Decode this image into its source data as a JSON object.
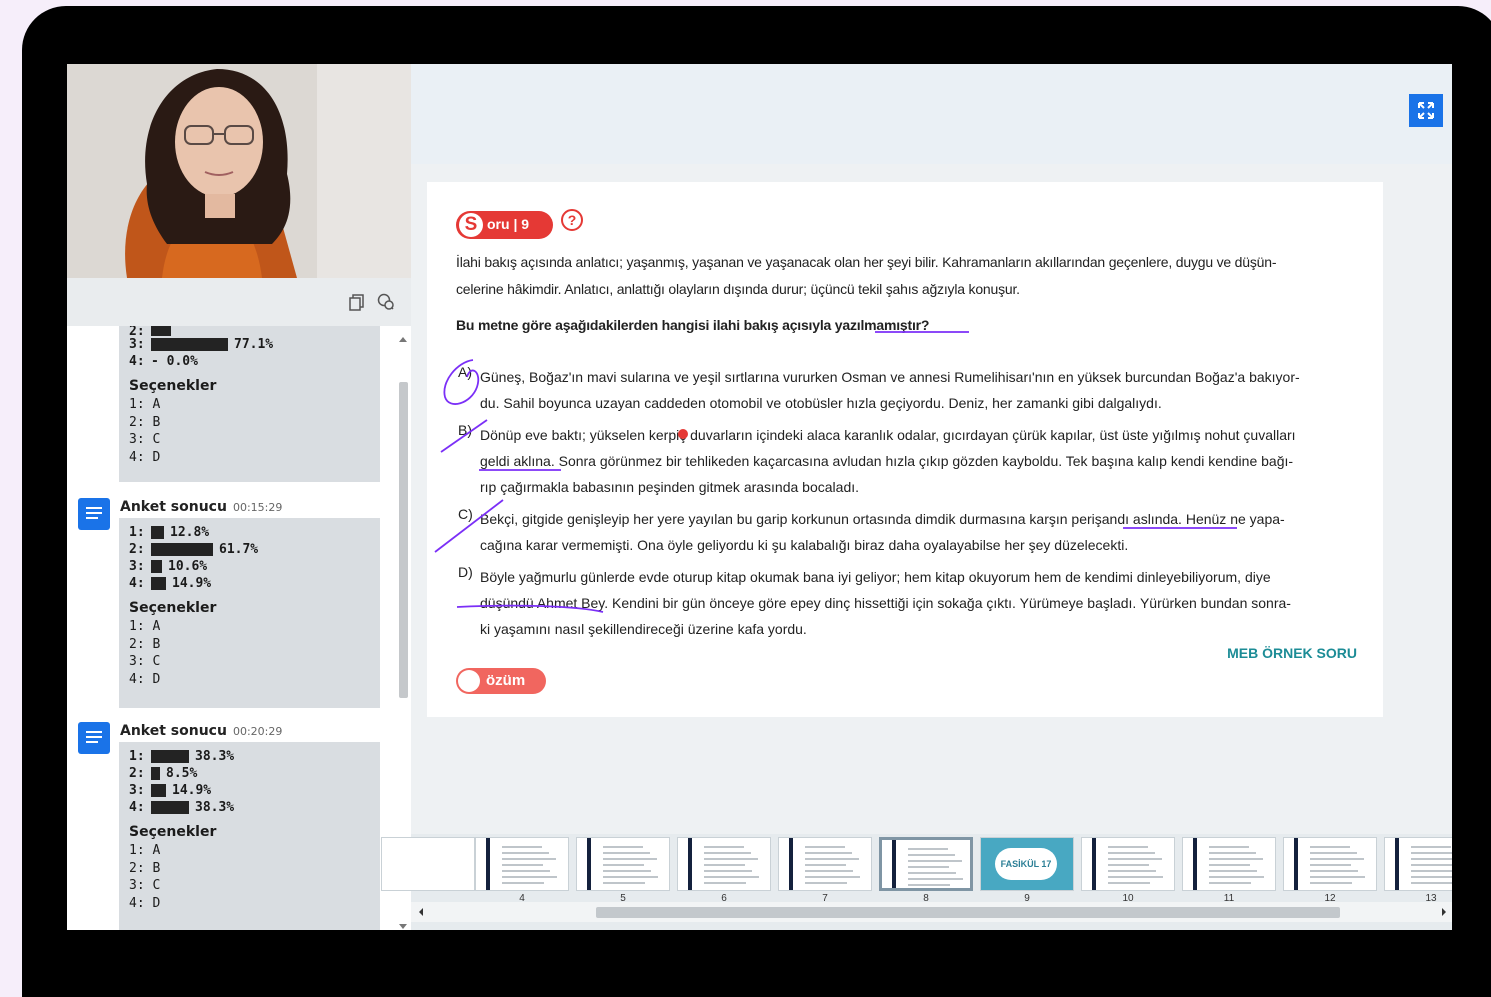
{
  "left_panel": {
    "partial_poll": {
      "rows": [
        {
          "n": "3:",
          "pct": "77.1%",
          "fill": 0.771
        },
        {
          "n": "4:",
          "pct": "- 0.0%",
          "fill": 0.0
        }
      ],
      "options_title": "Seçenekler",
      "options": [
        "1: A",
        "2: B",
        "3: C",
        "4: D"
      ]
    },
    "polls": [
      {
        "title": "Anket sonucu",
        "time": "00:15:29",
        "rows": [
          {
            "n": "1:",
            "pct": "12.8%",
            "fill": 0.128
          },
          {
            "n": "2:",
            "pct": "61.7%",
            "fill": 0.617
          },
          {
            "n": "3:",
            "pct": "10.6%",
            "fill": 0.106
          },
          {
            "n": "4:",
            "pct": "14.9%",
            "fill": 0.149
          }
        ],
        "options_title": "Seçenekler",
        "options": [
          "1: A",
          "2: B",
          "3: C",
          "4: D"
        ]
      },
      {
        "title": "Anket sonucu",
        "time": "00:20:29",
        "rows": [
          {
            "n": "1:",
            "pct": "38.3%",
            "fill": 0.383
          },
          {
            "n": "2:",
            "pct": "8.5%",
            "fill": 0.085
          },
          {
            "n": "3:",
            "pct": "14.9%",
            "fill": 0.149
          },
          {
            "n": "4:",
            "pct": "38.3%",
            "fill": 0.383
          }
        ],
        "options_title": "Seçenekler",
        "options": [
          "1: A",
          "2: B",
          "3: C",
          "4: D"
        ]
      }
    ]
  },
  "question": {
    "badge": "oru | 9",
    "badge_letter": "S",
    "help": "?",
    "passage": [
      "İlahi bakış açısında anlatıcı; yaşanmış, yaşanan ve yaşanacak olan her şeyi bilir. Kahramanların akıllarından geçenlere, duygu ve düşün-",
      "celerine hâkimdir. Anlatıcı, anlattığı olayların dışında durur; üçüncü tekil şahıs ağzıyla konuşur."
    ],
    "prompt": "Bu metne göre aşağıdakilerden hangisi ilahi bakış açısıyla yazılmamıştır?",
    "options": [
      {
        "letter": "A)",
        "lines": [
          "Güneş, Boğaz'ın mavi sularına ve yeşil sırtlarına vururken Osman ve annesi Rumelihisarı'nın en yüksek burcundan Boğaz'a bakıyor-",
          "du. Sahil boyunca uzayan caddeden otomobil ve otobüsler hızla geçiyordu. Deniz, her zamanki gibi dalgalıydı."
        ]
      },
      {
        "letter": "B)",
        "lines": [
          "Dönüp eve baktı; yükselen kerpiç duvarların içindeki alaca karanlık odalar, gıcırdayan çürük kapılar, üst üste yığılmış nohut çuvalları",
          "geldi aklına. Sonra görünmez bir tehlikeden kaçarcasına avludan hızla çıkıp gözden kayboldu. Tek başına kalıp kendi kendine bağı-",
          "rıp çağırmakla babasının peşinden gitmek arasında bocaladı."
        ]
      },
      {
        "letter": "C)",
        "lines": [
          "Bekçi, gitgide genişleyip her yere yayılan bu garip korkunun ortasında dimdik durmasına karşın perişandı aslında. Henüz ne yapa-",
          "cağına karar vermemişti. Ona öyle geliyordu ki şu kalabalığı biraz daha oyalayabilse her şey düzelecekti."
        ]
      },
      {
        "letter": "D)",
        "lines": [
          "Böyle yağmurlu günlerde evde oturup kitap okumak bana iyi geliyor; hem kitap okuyorum hem de kendimi dinleyebiliyorum, diye",
          "düşündü Ahmet Bey. Kendini bir gün önceye göre epey dinç hissettiği için sokağa çıktı. Yürümeye başladı. Yürürken bundan sonra-",
          "ki yaşamını nasıl şekillendireceği üzerine kafa yordu."
        ]
      }
    ],
    "source": "MEB ÖRNEK SORU",
    "solution_label": "özüm",
    "annotation_color": "#7b2ff7"
  },
  "thumbnails": [
    {
      "num": "4"
    },
    {
      "num": "5"
    },
    {
      "num": "6"
    },
    {
      "num": "7"
    },
    {
      "num": "8",
      "active": true
    },
    {
      "num": "9",
      "label": "FASİKÜL 17"
    },
    {
      "num": "10"
    },
    {
      "num": "11"
    },
    {
      "num": "12"
    },
    {
      "num": "13"
    }
  ],
  "icons": {
    "copy": "copy-icon",
    "chat": "chat-icon",
    "fullscreen": "fullscreen-icon"
  },
  "colors": {
    "accent": "#1a73e8",
    "badge_red": "#e53935",
    "source_teal": "#1c8c96"
  }
}
